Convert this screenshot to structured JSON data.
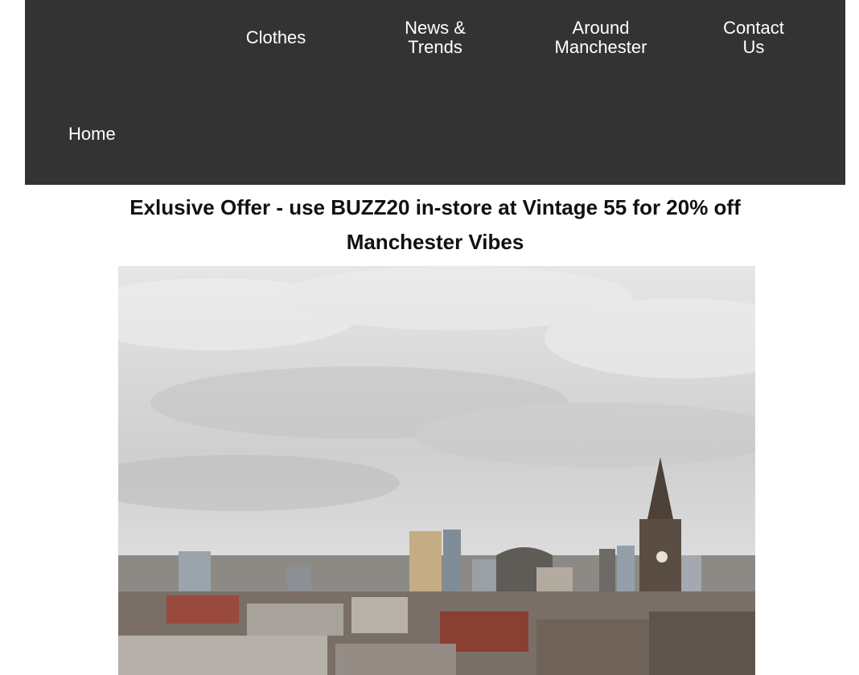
{
  "nav": {
    "clothes": "Clothes",
    "news": "News &\nTrends",
    "around": "Around\nManchester",
    "contact": "Contact\nUs",
    "home": "Home"
  },
  "offer": {
    "text": "Exlusive Offer - use BUZZ20 in-store at Vintage 55 for 20% off"
  },
  "section": {
    "title": "Manchester Vibes"
  },
  "colors": {
    "navbar_bg": "#333333",
    "nav_text": "#ffffff",
    "heading_text": "#111111"
  }
}
